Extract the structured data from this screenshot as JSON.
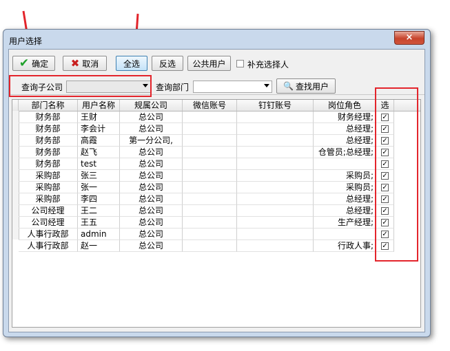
{
  "window": {
    "title": "用户选择",
    "close_label": "×"
  },
  "toolbar": {
    "ok_label": "确定",
    "cancel_label": "取消",
    "select_all_label": "全选",
    "invert_label": "反选",
    "public_users_label": "公共用户",
    "supplement_label": "补充选择人"
  },
  "filters": {
    "subcompany_label": "查询子公司",
    "subcompany_value": "",
    "department_label": "查询部门",
    "department_value": "",
    "find_user_label": "查找用户"
  },
  "grid": {
    "columns": [
      "部门名称",
      "用户名称",
      "规属公司",
      "微信账号",
      "钉钉账号",
      "岗位角色",
      "选"
    ],
    "rows": [
      {
        "dept": "财务部",
        "user": "王财",
        "company": "总公司",
        "wechat": "",
        "dingtalk": "",
        "role": "财务经理;",
        "checked": true
      },
      {
        "dept": "财务部",
        "user": "李会计",
        "company": "总公司",
        "wechat": "",
        "dingtalk": "",
        "role": "总经理;",
        "checked": true
      },
      {
        "dept": "财务部",
        "user": "高霞",
        "company": "第一分公司,",
        "wechat": "",
        "dingtalk": "",
        "role": "总经理;",
        "checked": true
      },
      {
        "dept": "财务部",
        "user": "赵飞",
        "company": "总公司",
        "wechat": "",
        "dingtalk": "",
        "role": "仓管员;总经理;",
        "checked": true
      },
      {
        "dept": "财务部",
        "user": "test",
        "company": "总公司",
        "wechat": "",
        "dingtalk": "",
        "role": "",
        "checked": true
      },
      {
        "dept": "采购部",
        "user": "张三",
        "company": "总公司",
        "wechat": "",
        "dingtalk": "",
        "role": "采购员;",
        "checked": true
      },
      {
        "dept": "采购部",
        "user": "张一",
        "company": "总公司",
        "wechat": "",
        "dingtalk": "",
        "role": "采购员;",
        "checked": true
      },
      {
        "dept": "采购部",
        "user": "李四",
        "company": "总公司",
        "wechat": "",
        "dingtalk": "",
        "role": "总经理;",
        "checked": true
      },
      {
        "dept": "公司经理",
        "user": "王二",
        "company": "总公司",
        "wechat": "",
        "dingtalk": "",
        "role": "总经理;",
        "checked": true
      },
      {
        "dept": "公司经理",
        "user": "王五",
        "company": "总公司",
        "wechat": "",
        "dingtalk": "",
        "role": "生产经理;",
        "checked": true
      },
      {
        "dept": "人事行政部",
        "user": "admin",
        "company": "总公司",
        "wechat": "",
        "dingtalk": "",
        "role": "",
        "checked": true
      },
      {
        "dept": "人事行政部",
        "user": "赵一",
        "company": "总公司",
        "wechat": "",
        "dingtalk": "",
        "role": "行政人事;",
        "checked": true
      }
    ]
  },
  "colors": {
    "annotation": "#e3242b",
    "window_frame": "#c9d9ec",
    "ok_icon": "#1fa02a",
    "cancel_icon": "#c81e1e"
  }
}
